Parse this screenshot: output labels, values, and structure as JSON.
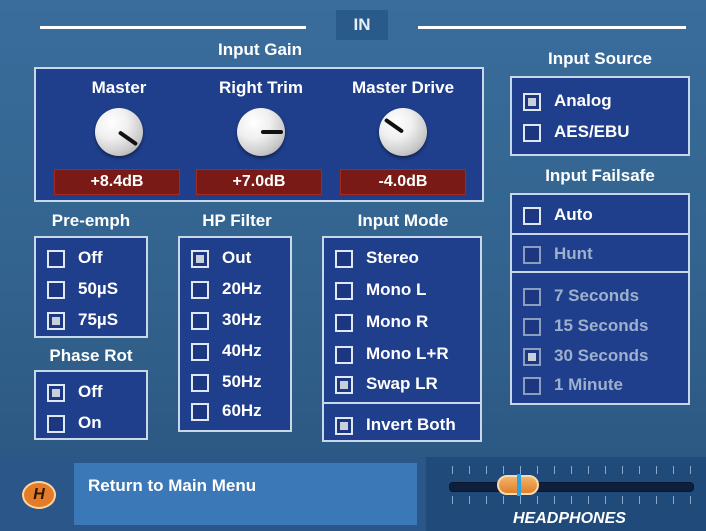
{
  "header": {
    "title": "IN"
  },
  "input_gain": {
    "title": "Input Gain",
    "knobs": [
      {
        "label": "Master",
        "value": "+8.4dB"
      },
      {
        "label": "Right Trim",
        "value": "+7.0dB"
      },
      {
        "label": "Master Drive",
        "value": "-4.0dB"
      }
    ]
  },
  "input_source": {
    "title": "Input Source",
    "options": [
      {
        "label": "Analog",
        "checked": true
      },
      {
        "label": "AES/EBU",
        "checked": false
      }
    ]
  },
  "input_failsafe": {
    "title": "Input Failsafe",
    "auto": {
      "label": "Auto",
      "checked": false
    },
    "hunt": {
      "label": "Hunt",
      "checked": false
    },
    "times": [
      {
        "label": "7 Seconds",
        "checked": false
      },
      {
        "label": "15 Seconds",
        "checked": false
      },
      {
        "label": "30 Seconds",
        "checked": true
      },
      {
        "label": "1 Minute",
        "checked": false
      }
    ]
  },
  "pre_emph": {
    "title": "Pre-emph",
    "options": [
      {
        "label": "Off",
        "checked": false
      },
      {
        "label": "50µS",
        "checked": false
      },
      {
        "label": "75µS",
        "checked": true
      }
    ]
  },
  "phase_rot": {
    "title": "Phase Rot",
    "options": [
      {
        "label": "Off",
        "checked": true
      },
      {
        "label": "On",
        "checked": false
      }
    ]
  },
  "hp_filter": {
    "title": "HP Filter",
    "options": [
      {
        "label": "Out",
        "checked": true
      },
      {
        "label": "20Hz",
        "checked": false
      },
      {
        "label": "30Hz",
        "checked": false
      },
      {
        "label": "40Hz",
        "checked": false
      },
      {
        "label": "50Hz",
        "checked": false
      },
      {
        "label": "60Hz",
        "checked": false
      }
    ]
  },
  "input_mode": {
    "title": "Input Mode",
    "options": [
      {
        "label": "Stereo",
        "checked": false
      },
      {
        "label": "Mono L",
        "checked": false
      },
      {
        "label": "Mono R",
        "checked": false
      },
      {
        "label": "Mono L+R",
        "checked": false
      },
      {
        "label": "Swap LR",
        "checked": true
      }
    ],
    "invert": {
      "label": "Invert Both",
      "checked": true
    }
  },
  "footer": {
    "home_button": "H",
    "return_label": "Return to Main Menu",
    "headphones_label": "HEADPHONES"
  }
}
